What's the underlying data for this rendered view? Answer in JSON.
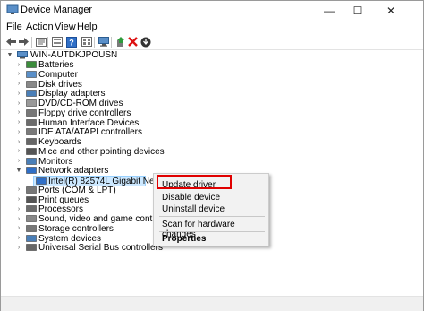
{
  "window": {
    "title": "Device Manager",
    "controls": {
      "minimize": "—",
      "maximize": "☐",
      "close": "✕"
    }
  },
  "menu": [
    "File",
    "Action",
    "View",
    "Help"
  ],
  "toolbar": [
    "back-icon",
    "forward-icon",
    "properties-icon",
    "show-hidden-icon",
    "help-icon",
    "view-icon",
    "computer-icon",
    "update-driver-icon",
    "uninstall-icon",
    "download-icon"
  ],
  "tree": {
    "root": "WIN-AUTDKJPOUSN",
    "items": [
      {
        "label": "Batteries",
        "icon": "battery-icon"
      },
      {
        "label": "Computer",
        "icon": "computer-icon"
      },
      {
        "label": "Disk drives",
        "icon": "disk-icon"
      },
      {
        "label": "Display adapters",
        "icon": "display-icon"
      },
      {
        "label": "DVD/CD-ROM drives",
        "icon": "dvd-icon"
      },
      {
        "label": "Floppy drive controllers",
        "icon": "floppy-icon"
      },
      {
        "label": "Human Interface Devices",
        "icon": "hid-icon"
      },
      {
        "label": "IDE ATA/ATAPI controllers",
        "icon": "ide-icon"
      },
      {
        "label": "Keyboards",
        "icon": "keyboard-icon"
      },
      {
        "label": "Mice and other pointing devices",
        "icon": "mouse-icon"
      },
      {
        "label": "Monitors",
        "icon": "monitor-icon"
      },
      {
        "label": "Network adapters",
        "icon": "network-icon"
      },
      {
        "label": "Intel(R) 82574L Gigabit Network C",
        "icon": "network-card-icon"
      },
      {
        "label": "Ports (COM & LPT)",
        "icon": "port-icon"
      },
      {
        "label": "Print queues",
        "icon": "printer-icon"
      },
      {
        "label": "Processors",
        "icon": "processor-icon"
      },
      {
        "label": "Sound, video and game controllers",
        "icon": "sound-icon"
      },
      {
        "label": "Storage controllers",
        "icon": "storage-icon"
      },
      {
        "label": "System devices",
        "icon": "system-icon"
      },
      {
        "label": "Universal Serial Bus controllers",
        "icon": "usb-icon"
      }
    ]
  },
  "context_menu": {
    "update_driver": "Update driver",
    "disable_device": "Disable device",
    "uninstall_device": "Uninstall device",
    "scan": "Scan for hardware changes",
    "properties": "Properties"
  },
  "colors": {
    "highlight": "#e00000",
    "selected_bg": "#cce8ff"
  }
}
